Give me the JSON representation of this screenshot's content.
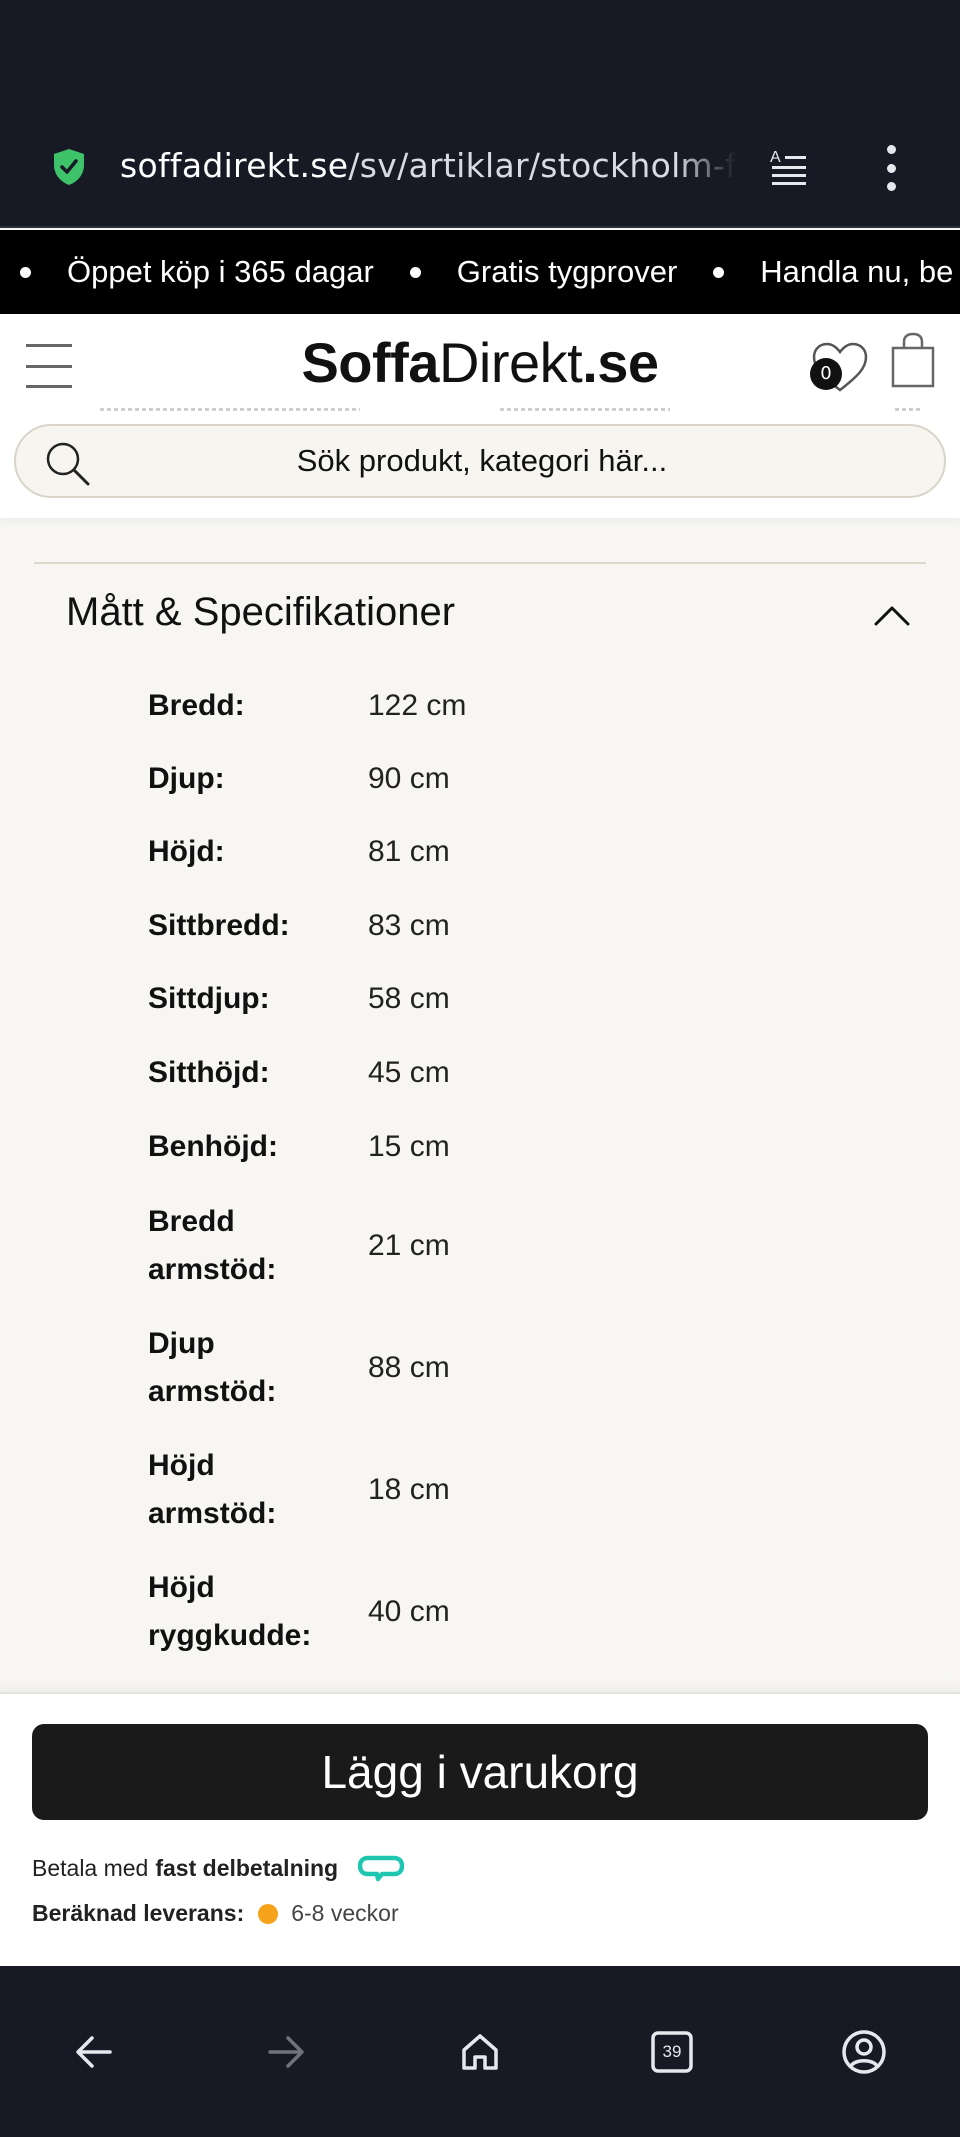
{
  "browser": {
    "url_host": "soffadirekt.se",
    "url_path": "/sv/artiklar/stockholm-f",
    "tab_count": "39"
  },
  "marquee": {
    "items": [
      "Öppet köp i 365 dagar",
      "Gratis tygprover",
      "Handla nu, be"
    ]
  },
  "header": {
    "logo_bold": "Soffa",
    "logo_regular": "Direkt",
    "logo_suffix": ".se",
    "wishlist_count": "0",
    "search_placeholder": "Sök produkt, kategori här..."
  },
  "specs": {
    "title": "Mått & Specifikationer",
    "rows": [
      {
        "label": "Bredd:",
        "value": "122 cm"
      },
      {
        "label": "Djup:",
        "value": "90 cm"
      },
      {
        "label": "Höjd:",
        "value": "81 cm"
      },
      {
        "label": "Sittbredd:",
        "value": "83 cm"
      },
      {
        "label": "Sittdjup:",
        "value": "58 cm"
      },
      {
        "label": "Sitthöjd:",
        "value": "45 cm"
      },
      {
        "label": "Benhöjd:",
        "value": "15 cm"
      },
      {
        "label": "Bredd armstöd:",
        "value": "21 cm"
      },
      {
        "label": "Djup armstöd:",
        "value": "88 cm"
      },
      {
        "label": "Höjd armstöd:",
        "value": "18 cm"
      },
      {
        "label": "Höjd ryggkudde:",
        "value": "40 cm"
      }
    ]
  },
  "purchase": {
    "add_to_cart_label": "Lägg i varukorg",
    "payment_prefix": "Betala med",
    "payment_bold": "fast delbetalning",
    "delivery_label": "Beräknad leverans:",
    "delivery_value": "6-8 veckor",
    "delivery_status_color": "#f7a21b"
  },
  "colors": {
    "browser_chrome": "#171a24",
    "brand_dark": "#1a1a1a",
    "shield_green": "#3ec26a",
    "payment_teal": "#1fc7b0"
  }
}
